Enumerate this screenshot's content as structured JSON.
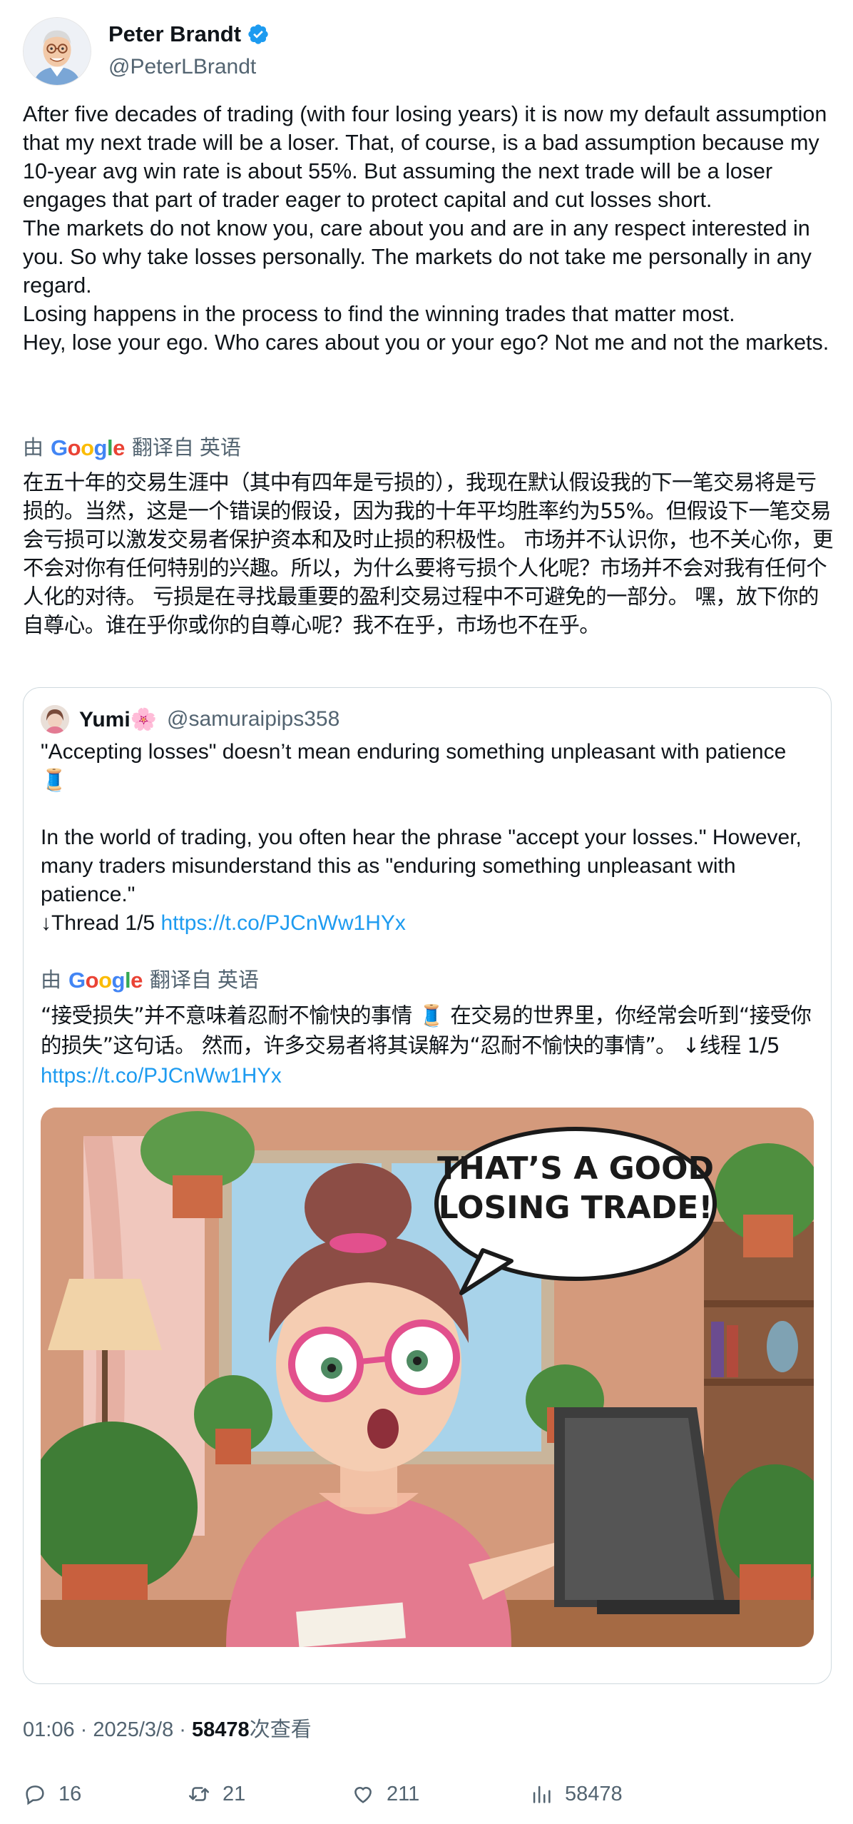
{
  "author": {
    "name": "Peter Brandt",
    "handle": "@PeterLBrandt",
    "verified": true,
    "verified_color": "#1d9bf0"
  },
  "tweet": {
    "text": "After five decades of trading (with four losing years) it is now my default assumption that my next trade will be a loser. That, of course, is a bad assumption because my 10-year avg win rate is about 55%. But assuming the next trade will be a loser engages that part of trader eager to protect capital and cut losses short.\nThe markets do not know you, care about you and are in any respect interested in you. So why take losses personally. The markets do not take me personally in any regard.\nLosing happens in the process to find the winning trades that matter most.\nHey, lose your ego. Who cares about you or your ego? Not me and not the markets.",
    "translation_prefix": "由",
    "translation_brand": "Google",
    "translation_suffix": "翻译自 英语",
    "translated_text": "在五十年的交易生涯中（其中有四年是亏损的），我现在默认假设我的下一笔交易将是亏损的。当然，这是一个错误的假设，因为我的十年平均胜率约为55%。但假设下一笔交易会亏损可以激发交易者保护资本和及时止损的积极性。 市场并不认识你，也不关心你，更不会对你有任何特别的兴趣。所以，为什么要将亏损个人化呢？市场并不会对我有任何个人化的对待。 亏损是在寻找最重要的盈利交易过程中不可避免的一部分。 嘿，放下你的自尊心。谁在乎你或你的自尊心呢？我不在乎，市场也不在乎。"
  },
  "quote": {
    "name": "Yumi🌸",
    "handle": "@samuraipips358",
    "text_line1": "\"Accepting losses\" doesn’t mean enduring something unpleasant with patience 🧵",
    "text_line2": "In the world of trading, you often hear the phrase \"accept your losses.\" However, many traders misunderstand this as \"enduring something unpleasant with patience.\"",
    "thread_label": "↓Thread 1/5 ",
    "link": "https://t.co/PJCnWw1HYx",
    "translation_prefix": "由",
    "translation_brand": "Google",
    "translation_suffix": "翻译自 英语",
    "translated_text": "“接受损失”并不意味着忍耐不愉快的事情 🧵 在交易的世界里，你经常会听到“接受你的损失”这句话。 然而，许多交易者将其误解为“忍耐不愉快的事情”。 ↓线程 1/5 ",
    "translated_link": "https://t.co/PJCnWw1HYx",
    "image_caption_line1": "THAT’S A GOOD",
    "image_caption_line2": "LOSING TRADE!"
  },
  "meta": {
    "time": "01:06",
    "separator": " · ",
    "date": "2025/3/8",
    "views_count": "58478",
    "views_label": "次查看"
  },
  "actions": {
    "replies": "16",
    "retweets": "21",
    "likes": "211",
    "views": "58478"
  }
}
